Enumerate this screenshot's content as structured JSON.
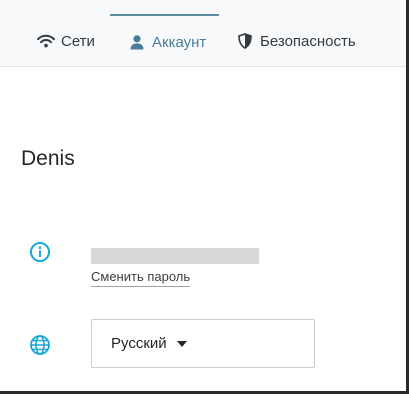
{
  "tabs": {
    "networks": {
      "label": "Сети",
      "icon": "wifi-icon"
    },
    "account": {
      "label": "Аккаунт",
      "icon": "user-icon",
      "active": true
    },
    "security": {
      "label": "Безопасность",
      "icon": "shield-icon"
    }
  },
  "account": {
    "username": "Denis",
    "change_password_label": "Сменить пароль",
    "language": "Русский"
  },
  "colors": {
    "accent": "#4a7d98",
    "icon": "#1aa6d9"
  }
}
